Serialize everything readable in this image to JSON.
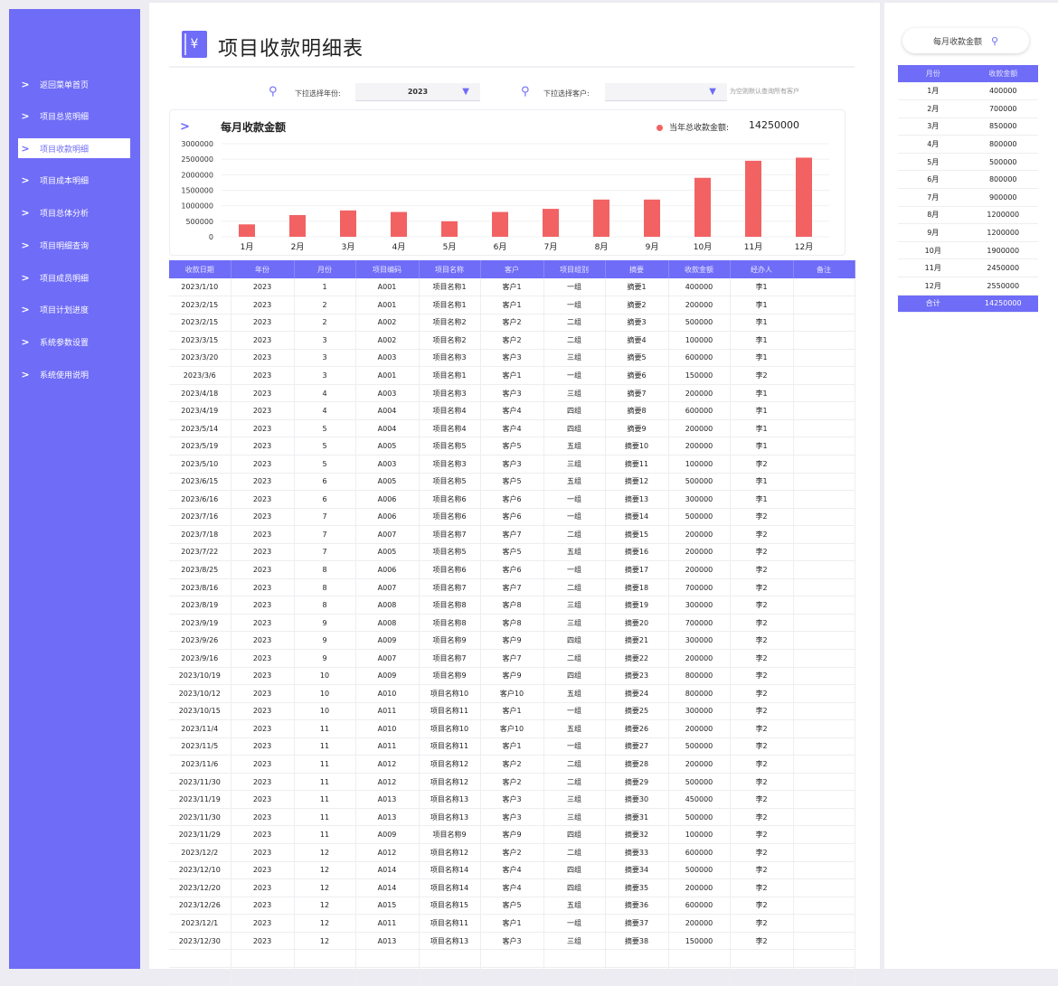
{
  "sidebar": {
    "items": [
      {
        "label": "返回菜单首页",
        "active": false
      },
      {
        "label": "项目总览明细",
        "active": false
      },
      {
        "label": "项目收款明细",
        "active": true
      },
      {
        "label": "项目成本明细",
        "active": false
      },
      {
        "label": "项目总体分析",
        "active": false
      },
      {
        "label": "项目明细查询",
        "active": false
      },
      {
        "label": "项目成员明细",
        "active": false
      },
      {
        "label": "项目计划进度",
        "active": false
      },
      {
        "label": "系统参数设置",
        "active": false
      },
      {
        "label": "系统使用说明",
        "active": false
      }
    ]
  },
  "header": {
    "title": "项目收款明细表",
    "icon_glyph": "¥"
  },
  "filters": {
    "year_label": "下拉选择年份:",
    "year_value": "2023",
    "customer_label": "下拉选择客户:",
    "customer_value": "",
    "hint": "为空则默认查询所有客户"
  },
  "chart": {
    "title": "每月收款金额",
    "total_label": "当年总收款金额:",
    "total_value": "14250000"
  },
  "chart_data": {
    "type": "bar",
    "categories": [
      "1月",
      "2月",
      "3月",
      "4月",
      "5月",
      "6月",
      "7月",
      "8月",
      "9月",
      "10月",
      "11月",
      "12月"
    ],
    "values": [
      400000,
      700000,
      850000,
      800000,
      500000,
      800000,
      900000,
      1200000,
      1200000,
      1900000,
      2450000,
      2550000
    ],
    "yticks": [
      "3000000",
      "2500000",
      "2000000",
      "1500000",
      "1000000",
      "500000",
      "0"
    ],
    "ylim": [
      0,
      3000000
    ],
    "bar_color": "#f26263",
    "title": "每月收款金额"
  },
  "table": {
    "columns": [
      "收款日期",
      "年份",
      "月份",
      "项目编码",
      "项目名称",
      "客户",
      "项目组别",
      "摘要",
      "收款金额",
      "经办人",
      "备注"
    ],
    "rows": [
      [
        "2023/1/10",
        "2023",
        "1",
        "A001",
        "项目名称1",
        "客户1",
        "一组",
        "摘要1",
        "400000",
        "李1",
        ""
      ],
      [
        "2023/2/15",
        "2023",
        "2",
        "A001",
        "项目名称1",
        "客户1",
        "一组",
        "摘要2",
        "200000",
        "李1",
        ""
      ],
      [
        "2023/2/15",
        "2023",
        "2",
        "A002",
        "项目名称2",
        "客户2",
        "二组",
        "摘要3",
        "500000",
        "李1",
        ""
      ],
      [
        "2023/3/15",
        "2023",
        "3",
        "A002",
        "项目名称2",
        "客户2",
        "二组",
        "摘要4",
        "100000",
        "李1",
        ""
      ],
      [
        "2023/3/20",
        "2023",
        "3",
        "A003",
        "项目名称3",
        "客户3",
        "三组",
        "摘要5",
        "600000",
        "李1",
        ""
      ],
      [
        "2023/3/6",
        "2023",
        "3",
        "A001",
        "项目名称1",
        "客户1",
        "一组",
        "摘要6",
        "150000",
        "李2",
        ""
      ],
      [
        "2023/4/18",
        "2023",
        "4",
        "A003",
        "项目名称3",
        "客户3",
        "三组",
        "摘要7",
        "200000",
        "李1",
        ""
      ],
      [
        "2023/4/19",
        "2023",
        "4",
        "A004",
        "项目名称4",
        "客户4",
        "四组",
        "摘要8",
        "600000",
        "李1",
        ""
      ],
      [
        "2023/5/14",
        "2023",
        "5",
        "A004",
        "项目名称4",
        "客户4",
        "四组",
        "摘要9",
        "200000",
        "李1",
        ""
      ],
      [
        "2023/5/19",
        "2023",
        "5",
        "A005",
        "项目名称5",
        "客户5",
        "五组",
        "摘要10",
        "200000",
        "李1",
        ""
      ],
      [
        "2023/5/10",
        "2023",
        "5",
        "A003",
        "项目名称3",
        "客户3",
        "三组",
        "摘要11",
        "100000",
        "李2",
        ""
      ],
      [
        "2023/6/15",
        "2023",
        "6",
        "A005",
        "项目名称5",
        "客户5",
        "五组",
        "摘要12",
        "500000",
        "李1",
        ""
      ],
      [
        "2023/6/16",
        "2023",
        "6",
        "A006",
        "项目名称6",
        "客户6",
        "一组",
        "摘要13",
        "300000",
        "李1",
        ""
      ],
      [
        "2023/7/16",
        "2023",
        "7",
        "A006",
        "项目名称6",
        "客户6",
        "一组",
        "摘要14",
        "500000",
        "李2",
        ""
      ],
      [
        "2023/7/18",
        "2023",
        "7",
        "A007",
        "项目名称7",
        "客户7",
        "二组",
        "摘要15",
        "200000",
        "李2",
        ""
      ],
      [
        "2023/7/22",
        "2023",
        "7",
        "A005",
        "项目名称5",
        "客户5",
        "五组",
        "摘要16",
        "200000",
        "李2",
        ""
      ],
      [
        "2023/8/25",
        "2023",
        "8",
        "A006",
        "项目名称6",
        "客户6",
        "一组",
        "摘要17",
        "200000",
        "李2",
        ""
      ],
      [
        "2023/8/16",
        "2023",
        "8",
        "A007",
        "项目名称7",
        "客户7",
        "二组",
        "摘要18",
        "700000",
        "李2",
        ""
      ],
      [
        "2023/8/19",
        "2023",
        "8",
        "A008",
        "项目名称8",
        "客户8",
        "三组",
        "摘要19",
        "300000",
        "李2",
        ""
      ],
      [
        "2023/9/19",
        "2023",
        "9",
        "A008",
        "项目名称8",
        "客户8",
        "三组",
        "摘要20",
        "700000",
        "李2",
        ""
      ],
      [
        "2023/9/26",
        "2023",
        "9",
        "A009",
        "项目名称9",
        "客户9",
        "四组",
        "摘要21",
        "300000",
        "李2",
        ""
      ],
      [
        "2023/9/16",
        "2023",
        "9",
        "A007",
        "项目名称7",
        "客户7",
        "二组",
        "摘要22",
        "200000",
        "李2",
        ""
      ],
      [
        "2023/10/19",
        "2023",
        "10",
        "A009",
        "项目名称9",
        "客户9",
        "四组",
        "摘要23",
        "800000",
        "李2",
        ""
      ],
      [
        "2023/10/12",
        "2023",
        "10",
        "A010",
        "项目名称10",
        "客户10",
        "五组",
        "摘要24",
        "800000",
        "李2",
        ""
      ],
      [
        "2023/10/15",
        "2023",
        "10",
        "A011",
        "项目名称11",
        "客户1",
        "一组",
        "摘要25",
        "300000",
        "李2",
        ""
      ],
      [
        "2023/11/4",
        "2023",
        "11",
        "A010",
        "项目名称10",
        "客户10",
        "五组",
        "摘要26",
        "200000",
        "李2",
        ""
      ],
      [
        "2023/11/5",
        "2023",
        "11",
        "A011",
        "项目名称11",
        "客户1",
        "一组",
        "摘要27",
        "500000",
        "李2",
        ""
      ],
      [
        "2023/11/6",
        "2023",
        "11",
        "A012",
        "项目名称12",
        "客户2",
        "二组",
        "摘要28",
        "200000",
        "李2",
        ""
      ],
      [
        "2023/11/30",
        "2023",
        "11",
        "A012",
        "项目名称12",
        "客户2",
        "二组",
        "摘要29",
        "500000",
        "李2",
        ""
      ],
      [
        "2023/11/19",
        "2023",
        "11",
        "A013",
        "项目名称13",
        "客户3",
        "三组",
        "摘要30",
        "450000",
        "李2",
        ""
      ],
      [
        "2023/11/30",
        "2023",
        "11",
        "A013",
        "项目名称13",
        "客户3",
        "三组",
        "摘要31",
        "500000",
        "李2",
        ""
      ],
      [
        "2023/11/29",
        "2023",
        "11",
        "A009",
        "项目名称9",
        "客户9",
        "四组",
        "摘要32",
        "100000",
        "李2",
        ""
      ],
      [
        "2023/12/2",
        "2023",
        "12",
        "A012",
        "项目名称12",
        "客户2",
        "二组",
        "摘要33",
        "600000",
        "李2",
        ""
      ],
      [
        "2023/12/10",
        "2023",
        "12",
        "A014",
        "项目名称14",
        "客户4",
        "四组",
        "摘要34",
        "500000",
        "李2",
        ""
      ],
      [
        "2023/12/20",
        "2023",
        "12",
        "A014",
        "项目名称14",
        "客户4",
        "四组",
        "摘要35",
        "200000",
        "李2",
        ""
      ],
      [
        "2023/12/26",
        "2023",
        "12",
        "A015",
        "项目名称15",
        "客户5",
        "五组",
        "摘要36",
        "600000",
        "李2",
        ""
      ],
      [
        "2023/12/1",
        "2023",
        "12",
        "A011",
        "项目名称11",
        "客户1",
        "一组",
        "摘要37",
        "200000",
        "李2",
        ""
      ],
      [
        "2023/12/30",
        "2023",
        "12",
        "A013",
        "项目名称13",
        "客户3",
        "三组",
        "摘要38",
        "150000",
        "李2",
        ""
      ]
    ]
  },
  "summary": {
    "button_label": "每月收款金额",
    "columns": [
      "月份",
      "收款金额"
    ],
    "rows": [
      [
        "1月",
        "400000"
      ],
      [
        "2月",
        "700000"
      ],
      [
        "3月",
        "850000"
      ],
      [
        "4月",
        "800000"
      ],
      [
        "5月",
        "500000"
      ],
      [
        "6月",
        "800000"
      ],
      [
        "7月",
        "900000"
      ],
      [
        "8月",
        "1200000"
      ],
      [
        "9月",
        "1200000"
      ],
      [
        "10月",
        "1900000"
      ],
      [
        "11月",
        "2450000"
      ],
      [
        "12月",
        "2550000"
      ]
    ],
    "total_label": "合计",
    "total_value": "14250000"
  },
  "colors": {
    "accent": "#6f6cf7",
    "bar": "#f26263"
  }
}
